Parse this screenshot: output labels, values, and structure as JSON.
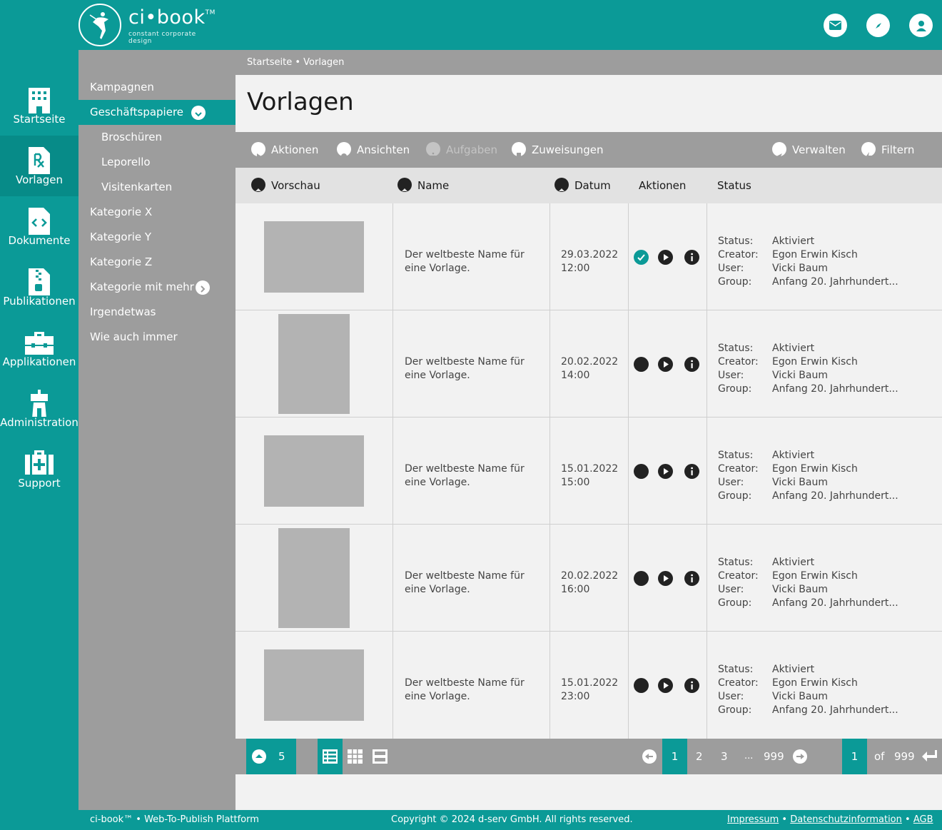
{
  "app": {
    "name": "ci•book",
    "tm": "TM",
    "tagline": "constant corporate design"
  },
  "top_icons": [
    "mail-icon",
    "compass-icon",
    "user-icon"
  ],
  "nav": [
    {
      "label": "Startseite",
      "icon": "building-icon"
    },
    {
      "label": "Vorlagen",
      "icon": "prescription-file-icon"
    },
    {
      "label": "Dokumente",
      "icon": "code-file-icon"
    },
    {
      "label": "Publikationen",
      "icon": "zip-file-icon"
    },
    {
      "label": "Applikationen",
      "icon": "toolbox-icon"
    },
    {
      "label": "Administration",
      "icon": "tower-icon"
    },
    {
      "label": "Support",
      "icon": "first-aid-icon"
    }
  ],
  "submenu": [
    {
      "label": "Kampagnen"
    },
    {
      "label": "Geschäftspapiere"
    },
    {
      "label": "Broschüren"
    },
    {
      "label": "Leporello"
    },
    {
      "label": "Visitenkarten"
    },
    {
      "label": "Kategorie X"
    },
    {
      "label": "Kategorie Y"
    },
    {
      "label": "Kategorie Z"
    },
    {
      "label": "Kategorie mit mehr"
    },
    {
      "label": "Irgendetwas"
    },
    {
      "label": "Wie auch immer"
    }
  ],
  "breadcrumb": "Startseite • Vorlagen",
  "page_title": "Vorlagen",
  "toolbar": {
    "aktionen": "Aktionen",
    "ansichten": "Ansichten",
    "aufgaben": "Aufgaben",
    "zuweisungen": "Zuweisungen",
    "verwalten": "Verwalten",
    "filtern": "Filtern"
  },
  "columns": {
    "vorschau": "Vorschau",
    "name": "Name",
    "datum": "Datum",
    "aktionen": "Aktionen",
    "status": "Status"
  },
  "status_labels": {
    "status": "Status:",
    "creator": "Creator:",
    "user": "User:",
    "group": "Group:"
  },
  "rows": [
    {
      "name": "Der weltbeste Name für eine Vorlage.",
      "date": "29.03.2022",
      "time": "12:00",
      "status": "Aktiviert",
      "creator": "Egon Erwin Kisch",
      "user": "Vicki Baum",
      "group": "Anfang 20. Jahrhundert..."
    },
    {
      "name": "Der weltbeste Name für eine Vorlage.",
      "date": "20.02.2022",
      "time": "14:00",
      "status": "Aktiviert",
      "creator": "Egon Erwin Kisch",
      "user": "Vicki Baum",
      "group": "Anfang 20. Jahrhundert..."
    },
    {
      "name": "Der weltbeste Name für eine Vorlage.",
      "date": "15.01.2022",
      "time": "15:00",
      "status": "Aktiviert",
      "creator": "Egon Erwin Kisch",
      "user": "Vicki Baum",
      "group": "Anfang 20. Jahrhundert..."
    },
    {
      "name": "Der weltbeste Name für eine Vorlage.",
      "date": "20.02.2022",
      "time": "16:00",
      "status": "Aktiviert",
      "creator": "Egon Erwin Kisch",
      "user": "Vicki Baum",
      "group": "Anfang 20. Jahrhundert..."
    },
    {
      "name": "Der weltbeste Name für eine Vorlage.",
      "date": "15.01.2022",
      "time": "23:00",
      "status": "Aktiviert",
      "creator": "Egon Erwin Kisch",
      "user": "Vicki Baum",
      "group": "Anfang 20. Jahrhundert..."
    }
  ],
  "pager": {
    "per_page": "5",
    "pages": [
      "1",
      "2",
      "3",
      "...",
      "999"
    ],
    "current": "1",
    "of": "of",
    "total": "999"
  },
  "footer": {
    "left": "ci-book™ • Web-To-Publish Plattform",
    "copyright": "Copyright © 2024 d-serv GmbH. All rights reserved.",
    "impressum": "Impressum",
    "sep1": "•",
    "datenschutz": "Datenschutzinformation",
    "sep2": "•",
    "agb": "AGB"
  },
  "colors": {
    "brand_teal": "#0b9a97",
    "menu_grey": "#9d9d9d",
    "content_bg": "#f2f2f2"
  }
}
